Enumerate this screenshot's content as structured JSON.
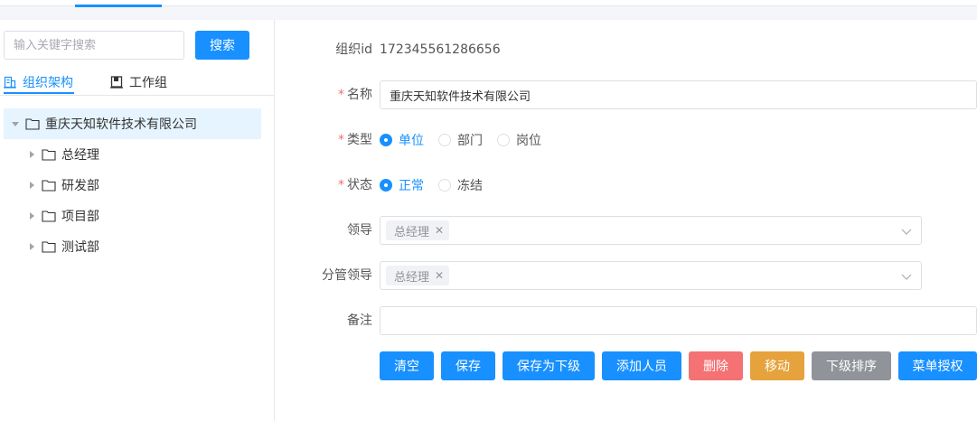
{
  "search": {
    "placeholder": "输入关键字搜索",
    "value": "",
    "button_label": "搜索"
  },
  "left_tabs": [
    {
      "label": "组织架构",
      "icon": "org-chart-icon",
      "active": true
    },
    {
      "label": "工作组",
      "icon": "book-icon",
      "active": false
    }
  ],
  "tree": {
    "root": {
      "label": "重庆天知软件技术有限公司",
      "expanded": true,
      "selected": true
    },
    "children": [
      {
        "label": "总经理"
      },
      {
        "label": "研发部"
      },
      {
        "label": "项目部"
      },
      {
        "label": "测试部"
      }
    ]
  },
  "form": {
    "org_id": {
      "label": "组织id",
      "value": "172345561286656"
    },
    "name": {
      "label": "名称",
      "required": true,
      "value": "重庆天知软件技术有限公司"
    },
    "type": {
      "label": "类型",
      "required": true,
      "options": [
        "单位",
        "部门",
        "岗位"
      ],
      "selected": "单位"
    },
    "status": {
      "label": "状态",
      "required": true,
      "options": [
        "正常",
        "冻结"
      ],
      "selected": "正常"
    },
    "leader": {
      "label": "领导",
      "tags": [
        "总经理"
      ]
    },
    "deputy_leader": {
      "label": "分管领导",
      "tags": [
        "总经理"
      ]
    },
    "remark": {
      "label": "备注",
      "value": ""
    }
  },
  "actions": [
    "清空",
    "保存",
    "保存为下级",
    "添加人员",
    "删除",
    "移动",
    "下级排序",
    "菜单授权"
  ],
  "colors": {
    "primary": "#1890ff",
    "danger": "#f47174",
    "warning": "#e6a23c",
    "info": "#909399",
    "required": "#f56c6c"
  }
}
